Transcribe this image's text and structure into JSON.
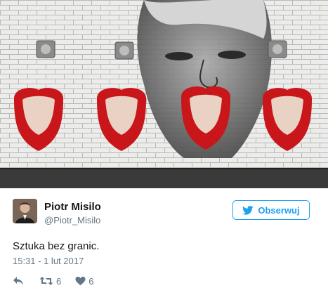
{
  "media": {
    "icon": "photo-urinals-icon",
    "colors": {
      "tile": "#e9e9e7",
      "lips": "#c8161a",
      "face": "#8d8d8d"
    }
  },
  "author": {
    "name": "Piotr Misilo",
    "handle": "@Piotr_Misilo",
    "avatar_icon": "avatar-icon"
  },
  "follow_button": {
    "label": "Obserwuj",
    "icon": "twitter-bird-icon",
    "color": "#1da1f2"
  },
  "tweet": {
    "text": "Sztuka bez granic.",
    "timestamp": "15:31 - 1 lut 2017"
  },
  "actions": {
    "reply_icon": "reply-icon",
    "retweet_icon": "retweet-icon",
    "retweet_count": "6",
    "like_icon": "heart-icon",
    "like_count": "6"
  }
}
